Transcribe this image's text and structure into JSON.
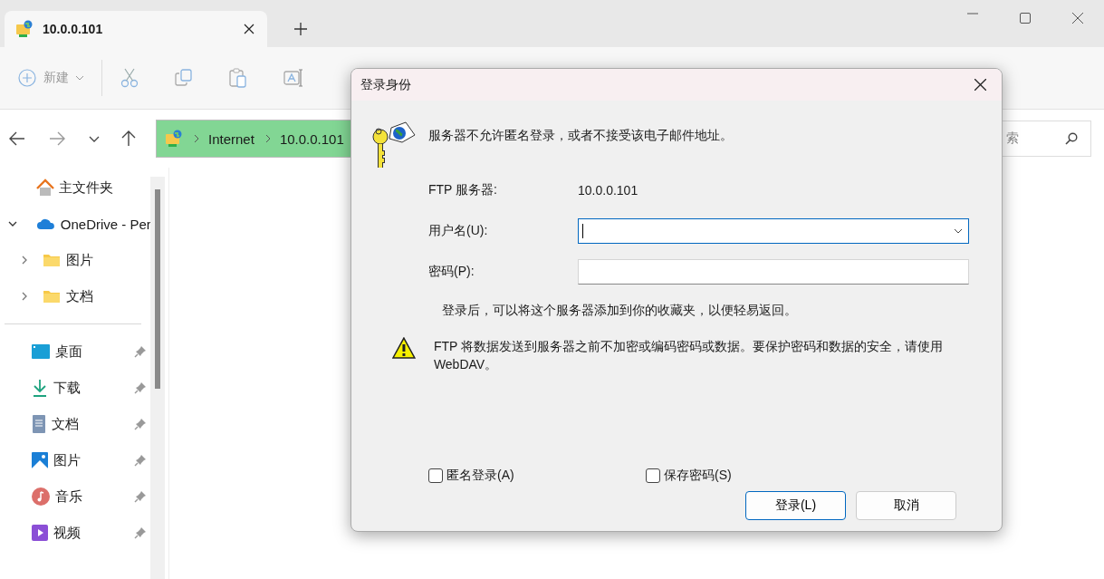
{
  "tab": {
    "title": "10.0.0.101",
    "selected": true
  },
  "toolbar": {
    "new_button": "新建"
  },
  "address_bar": {
    "segments": [
      "Internet",
      "10.0.0.101"
    ]
  },
  "search": {
    "placeholder": "索"
  },
  "nav_pane": {
    "items": [
      {
        "label": "主文件夹",
        "kind": "home"
      },
      {
        "label": "OneDrive - Per",
        "kind": "onedrive",
        "expanded": true,
        "children": [
          {
            "label": "图片",
            "kind": "folder",
            "expanded": false
          },
          {
            "label": "文档",
            "kind": "folder",
            "expanded": false
          }
        ]
      }
    ],
    "quick_access": [
      {
        "label": "桌面",
        "kind": "desktop",
        "pinned": true
      },
      {
        "label": "下载",
        "kind": "download",
        "pinned": true
      },
      {
        "label": "文档",
        "kind": "document",
        "pinned": true
      },
      {
        "label": "图片",
        "kind": "pictures",
        "pinned": true
      },
      {
        "label": "音乐",
        "kind": "music",
        "pinned": true
      },
      {
        "label": "视频",
        "kind": "video",
        "pinned": true
      }
    ]
  },
  "dialog": {
    "title": "登录身份",
    "message": "服务器不允许匿名登录，或者不接受该电子邮件地址。",
    "server_label": "FTP 服务器:",
    "server": "10.0.0.101",
    "fields": [
      {
        "label": "用户名(U):",
        "kind": "combo",
        "focused": true
      },
      {
        "label": "密码(P):",
        "kind": "password",
        "focused": false
      }
    ],
    "note": "登录后，可以将这个服务器添加到你的收藏夹，以便轻易返回。",
    "warning": "FTP 将数据发送到服务器之前不加密或编码密码或数据。要保护密码和数据的安全，请使用 WebDAV。",
    "checkboxes": [
      {
        "label": "匿名登录(A)",
        "checked": false
      },
      {
        "label": "保存密码(S)",
        "checked": false
      }
    ],
    "buttons": [
      {
        "label": "登录(L)",
        "default": true
      },
      {
        "label": "取消",
        "default": false
      }
    ]
  }
}
